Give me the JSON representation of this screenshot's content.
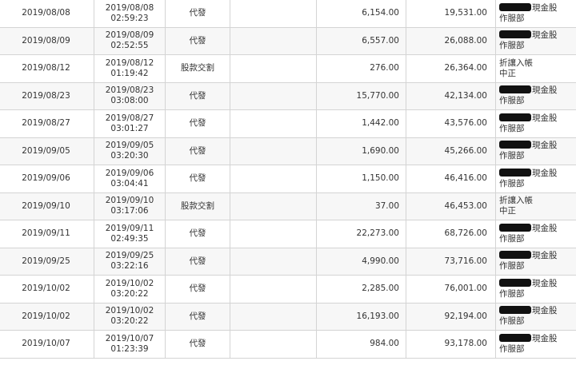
{
  "rows": [
    {
      "date": "2019/08/08",
      "time_date": "2019/08/08",
      "time_clock": "02:59:23",
      "type": "代發",
      "memo": "",
      "amount": "6,154.00",
      "balance": "19,531.00",
      "note_redacted": true,
      "note_line1": "現金股",
      "note_line2": "作服部"
    },
    {
      "date": "2019/08/09",
      "time_date": "2019/08/09",
      "time_clock": "02:52:55",
      "type": "代發",
      "memo": "",
      "amount": "6,557.00",
      "balance": "26,088.00",
      "note_redacted": true,
      "note_line1": "現金股",
      "note_line2": "作服部"
    },
    {
      "date": "2019/08/12",
      "time_date": "2019/08/12",
      "time_clock": "01:19:42",
      "type": "股款交割",
      "memo": "",
      "amount": "276.00",
      "balance": "26,364.00",
      "note_redacted": false,
      "note_line1": "折讓入帳",
      "note_line2": "中正"
    },
    {
      "date": "2019/08/23",
      "time_date": "2019/08/23",
      "time_clock": "03:08:00",
      "type": "代發",
      "memo": "",
      "amount": "15,770.00",
      "balance": "42,134.00",
      "note_redacted": true,
      "note_line1": "現金股",
      "note_line2": "作服部"
    },
    {
      "date": "2019/08/27",
      "time_date": "2019/08/27",
      "time_clock": "03:01:27",
      "type": "代發",
      "memo": "",
      "amount": "1,442.00",
      "balance": "43,576.00",
      "note_redacted": true,
      "note_line1": "現金股",
      "note_line2": "作服部"
    },
    {
      "date": "2019/09/05",
      "time_date": "2019/09/05",
      "time_clock": "03:20:30",
      "type": "代發",
      "memo": "",
      "amount": "1,690.00",
      "balance": "45,266.00",
      "note_redacted": true,
      "note_line1": "現金股",
      "note_line2": "作服部"
    },
    {
      "date": "2019/09/06",
      "time_date": "2019/09/06",
      "time_clock": "03:04:41",
      "type": "代發",
      "memo": "",
      "amount": "1,150.00",
      "balance": "46,416.00",
      "note_redacted": true,
      "note_line1": "現金股",
      "note_line2": "作服部"
    },
    {
      "date": "2019/09/10",
      "time_date": "2019/09/10",
      "time_clock": "03:17:06",
      "type": "股款交割",
      "memo": "",
      "amount": "37.00",
      "balance": "46,453.00",
      "note_redacted": false,
      "note_line1": "折讓入帳",
      "note_line2": "中正"
    },
    {
      "date": "2019/09/11",
      "time_date": "2019/09/11",
      "time_clock": "02:49:35",
      "type": "代發",
      "memo": "",
      "amount": "22,273.00",
      "balance": "68,726.00",
      "note_redacted": true,
      "note_line1": "現金股",
      "note_line2": "作服部"
    },
    {
      "date": "2019/09/25",
      "time_date": "2019/09/25",
      "time_clock": "03:22:16",
      "type": "代發",
      "memo": "",
      "amount": "4,990.00",
      "balance": "73,716.00",
      "note_redacted": true,
      "note_line1": "現金股",
      "note_line2": "作服部"
    },
    {
      "date": "2019/10/02",
      "time_date": "2019/10/02",
      "time_clock": "03:20:22",
      "type": "代發",
      "memo": "",
      "amount": "2,285.00",
      "balance": "76,001.00",
      "note_redacted": true,
      "note_line1": "現金股",
      "note_line2": "作服部"
    },
    {
      "date": "2019/10/02",
      "time_date": "2019/10/02",
      "time_clock": "03:20:22",
      "type": "代發",
      "memo": "",
      "amount": "16,193.00",
      "balance": "92,194.00",
      "note_redacted": true,
      "note_line1": "現金股",
      "note_line2": "作服部"
    },
    {
      "date": "2019/10/07",
      "time_date": "2019/10/07",
      "time_clock": "01:23:39",
      "type": "代發",
      "memo": "",
      "amount": "984.00",
      "balance": "93,178.00",
      "note_redacted": true,
      "note_line1": "現金股",
      "note_line2": "作服部"
    }
  ]
}
